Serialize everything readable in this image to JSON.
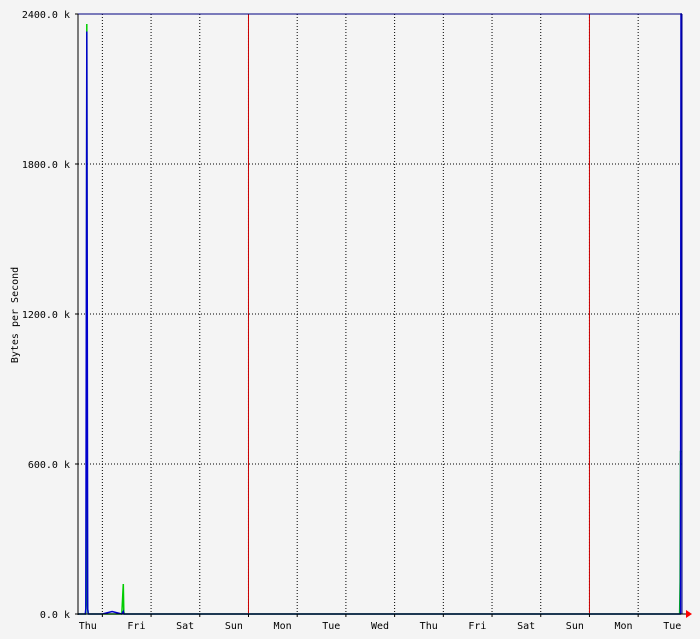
{
  "chart_data": {
    "type": "line",
    "title": "",
    "xlabel": "",
    "ylabel": "Bytes per Second",
    "ylim": [
      0,
      2400
    ],
    "yticks": [
      {
        "value": 0,
        "label": "0.0 k"
      },
      {
        "value": 600,
        "label": "600.0 k"
      },
      {
        "value": 1200,
        "label": "1200.0 k"
      },
      {
        "value": 1800,
        "label": "1800.0 k"
      },
      {
        "value": 2400,
        "label": "2400.0 k"
      }
    ],
    "xlim_days": [
      0,
      12.4
    ],
    "day_ticks": [
      {
        "day": 0.0,
        "label": "Thu"
      },
      {
        "day": 1.0,
        "label": "Fri"
      },
      {
        "day": 2.0,
        "label": "Sat"
      },
      {
        "day": 3.0,
        "label": "Sun"
      },
      {
        "day": 4.0,
        "label": "Mon"
      },
      {
        "day": 5.0,
        "label": "Tue"
      },
      {
        "day": 6.0,
        "label": "Wed"
      },
      {
        "day": 7.0,
        "label": "Thu"
      },
      {
        "day": 8.0,
        "label": "Fri"
      },
      {
        "day": 9.0,
        "label": "Sat"
      },
      {
        "day": 10.0,
        "label": "Sun"
      },
      {
        "day": 11.0,
        "label": "Mon"
      },
      {
        "day": 12.0,
        "label": "Tue"
      }
    ],
    "week_markers": [
      3.5,
      10.5
    ],
    "grid": true,
    "colors": {
      "background": "#f4f4f4",
      "plot_background": "#f4f4f4",
      "grid": "#000000",
      "week_marker": "#cc0000",
      "axis": "#000000",
      "border": "#000080",
      "arrow": "#ff0000"
    },
    "series": [
      {
        "color": "#00cc00",
        "x": [
          0,
          0.16,
          0.17,
          0.18,
          0.19,
          0.2,
          0.21,
          0.22,
          0.5,
          0.9,
          0.93,
          0.94,
          0.95,
          12.3,
          12.35,
          12.36,
          12.37,
          12.38,
          12.4
        ],
        "y": [
          0,
          0,
          60,
          2360,
          80,
          20,
          5,
          0,
          0,
          0,
          120,
          10,
          0,
          0,
          0,
          130,
          650,
          650,
          650
        ]
      },
      {
        "color": "#0000cc",
        "x": [
          0,
          0.15,
          0.16,
          0.17,
          0.18,
          0.19,
          0.2,
          0.21,
          0.5,
          0.7,
          0.9,
          0.93,
          0.94,
          0.95,
          12.3,
          12.36,
          12.37,
          12.38,
          12.4
        ],
        "y": [
          0,
          0,
          20,
          1150,
          2330,
          1150,
          20,
          0,
          0,
          10,
          0,
          10,
          0,
          0,
          0,
          0,
          0,
          2400,
          2400
        ]
      }
    ]
  }
}
